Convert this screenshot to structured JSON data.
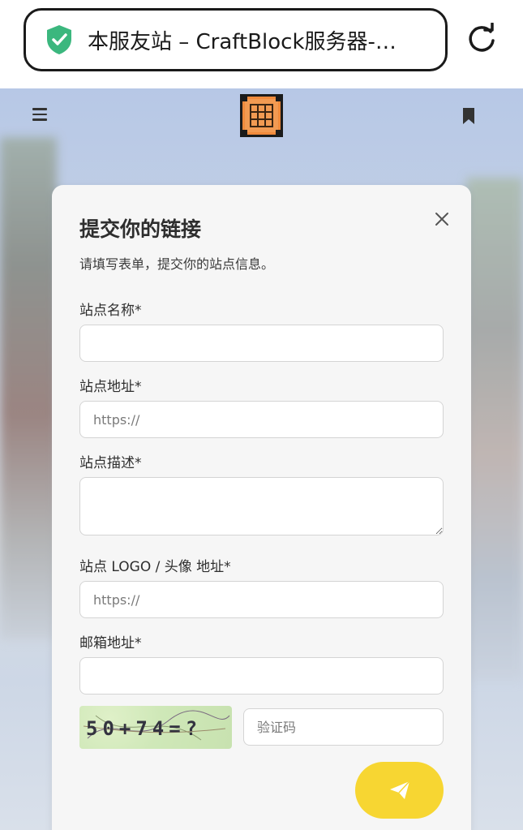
{
  "browser": {
    "url_text": "本服友站 – CraftBlock服务器-…",
    "icons": {
      "secure": "shield-check-icon",
      "reload": "reload-icon"
    },
    "accent_secure": "#3bb77e"
  },
  "nav": {
    "icons": {
      "menu": "menu-icon",
      "logo": "crafting-table-logo",
      "bookmark": "bookmark-icon"
    }
  },
  "modal": {
    "title": "提交你的链接",
    "subtitle": "请填写表单，提交你的站点信息。",
    "fields": {
      "site_name": {
        "label": "站点名称*",
        "value": "",
        "placeholder": ""
      },
      "site_url": {
        "label": "站点地址*",
        "value": "",
        "placeholder": "https://"
      },
      "site_desc": {
        "label": "站点描述*",
        "value": "",
        "placeholder": ""
      },
      "site_logo": {
        "label": "站点 LOGO / 头像 地址*",
        "value": "",
        "placeholder": "https://"
      },
      "email": {
        "label": "邮箱地址*",
        "value": "",
        "placeholder": ""
      },
      "captcha": {
        "image_text": "50+74=?",
        "placeholder": "验证码"
      }
    },
    "submit_icon": "paper-plane-icon",
    "submit_color": "#f7d632"
  }
}
